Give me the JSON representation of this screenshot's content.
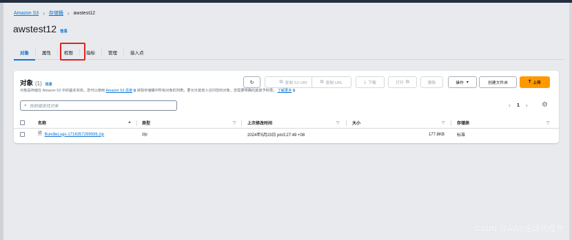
{
  "breadcrumb": {
    "root": "Amazon S3",
    "buckets": "存储桶",
    "current": "awstest12"
  },
  "page": {
    "title": "awstest12",
    "info": "信息"
  },
  "tabs": [
    {
      "label": "对象"
    },
    {
      "label": "属性"
    },
    {
      "label": "权限"
    },
    {
      "label": "指标"
    },
    {
      "label": "管理"
    },
    {
      "label": "接入点"
    }
  ],
  "objects_panel": {
    "title": "对象",
    "count": "(1)",
    "info": "信息",
    "desc_part1": "对象是存储在 Amazon S3 中的基本实体。您可以使用",
    "desc_link1": "Amazon S3 清单",
    "desc_part2": "获取存储桶中所有对象的列表。要允许其他人访问您的对象，您需要明确向其授予权限。",
    "desc_link2": "了解更多",
    "buttons": {
      "copy_s3_uri": "复制 S3 URI",
      "copy_url": "复制 URL",
      "download": "下载",
      "open": "打开",
      "delete": "删除",
      "actions": "操作",
      "create_folder": "创建文件夹",
      "upload": "上传"
    },
    "search_placeholder": "按前缀查找对象",
    "pagination": {
      "page": "1"
    },
    "columns": {
      "name": "名称",
      "type": "类型",
      "modified": "上次修改时间",
      "size": "大小",
      "storage_class": "存储类"
    },
    "rows": [
      {
        "name": "BundleLogs-1716357299936.zip",
        "type": "zip",
        "modified": "2024年5月23日 pm3:27:49 +08",
        "size": "177.8KB",
        "storage_class": "标准"
      }
    ]
  },
  "watermark": "CSDN @AWS全球代理商",
  "colors": {
    "accent": "#0972d3",
    "primary_button": "#ff9900",
    "highlight": "#e02020"
  }
}
